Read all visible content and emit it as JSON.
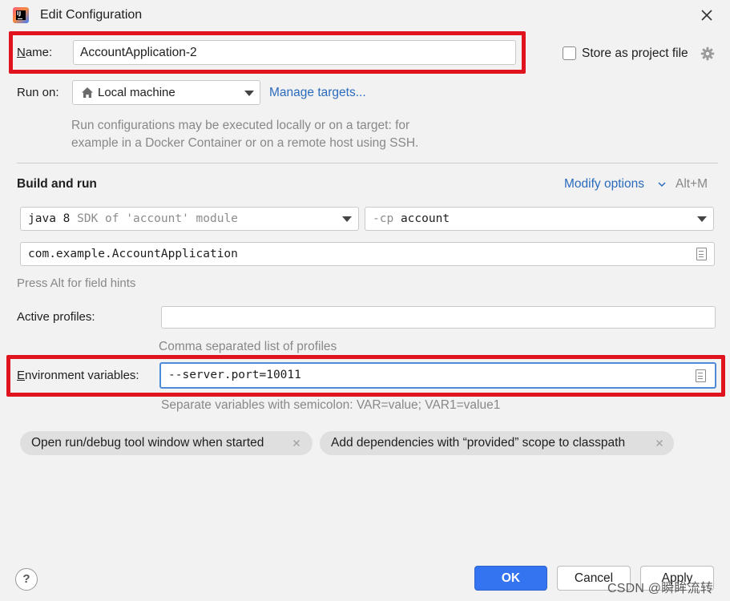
{
  "window": {
    "title": "Edit Configuration"
  },
  "name": {
    "label_key": "N",
    "label_rest": "ame:",
    "value": "AccountApplication-2"
  },
  "store": {
    "label": "Store as project file",
    "checked": false
  },
  "run_on": {
    "label": "Run on:",
    "value": "Local machine",
    "manage_link": "Manage targets...",
    "hint_line1": "Run configurations may be executed locally or on a target: for",
    "hint_line2": "example in a Docker Container or on a remote host using SSH."
  },
  "build": {
    "title": "Build and run",
    "modify_options": "Modify options",
    "modify_shortcut": "Alt+M",
    "jdk_main": "java 8",
    "jdk_detail": "SDK of 'account' module",
    "cp_flag": "-cp",
    "cp_value": "account",
    "main_class": "com.example.AccountApplication",
    "field_hint": "Press Alt for field hints"
  },
  "profiles": {
    "label": "Active profiles:",
    "value": "",
    "hint": "Comma separated list of profiles"
  },
  "env": {
    "label_key": "E",
    "label_rest": "nvironment variables:",
    "value": "--server.port=10011",
    "hint": "Separate variables with semicolon: VAR=value; VAR1=value1"
  },
  "chips": [
    {
      "label": "Open run/debug tool window when started"
    },
    {
      "label": "Add dependencies with “provided” scope to classpath"
    }
  ],
  "footer": {
    "help": "?",
    "ok": "OK",
    "cancel": "Cancel",
    "apply": "Apply"
  },
  "watermark": "CSDN @瞬眸流转",
  "colors": {
    "accent": "#3574f0",
    "link": "#2a6bbd",
    "highlight_red": "#e0141f"
  },
  "icons": {
    "app": "intellij-idea-icon",
    "close": "close-icon",
    "settings": "gear-icon",
    "target": "home-icon",
    "dropdown": "chevron-down-icon",
    "expand": "document-icon",
    "chip_remove": "close-icon",
    "help": "help-icon"
  }
}
